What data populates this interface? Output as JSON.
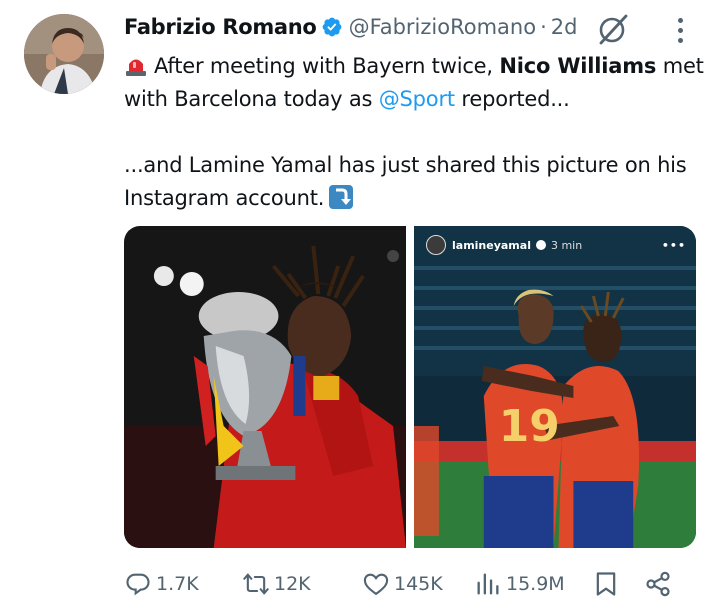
{
  "tweet": {
    "author_name": "Fabrizio Romano",
    "handle": "@FabrizioRomano",
    "separator": "·",
    "time": "2d",
    "text": {
      "p1_a": "After meeting with Bayern twice, ",
      "p1_bold": "Nico Williams",
      "p1_b": " met",
      "p1_c": "with Barcelona today as ",
      "p1_mention": "@Sport",
      "p1_d": " reported...",
      "p2_a": "...and Lamine Yamal has just shared this picture on his",
      "p2_b": "Instagram account."
    }
  },
  "media": {
    "right_story": {
      "username": "lamineyamal",
      "time": "3 min",
      "more": "•••"
    }
  },
  "actions": {
    "replies": "1.7K",
    "reposts": "12K",
    "likes": "145K",
    "views": "15.9M"
  },
  "colors": {
    "accent": "#1d9bf0",
    "secondary_text": "#536471",
    "primary_text": "#0f1419"
  },
  "icons": [
    "verified-badge-icon",
    "grok-icon",
    "more-icon",
    "siren-emoji-icon",
    "arrow-down-emoji-icon",
    "reply-icon",
    "repost-icon",
    "like-icon",
    "views-icon",
    "bookmark-icon",
    "share-icon"
  ]
}
